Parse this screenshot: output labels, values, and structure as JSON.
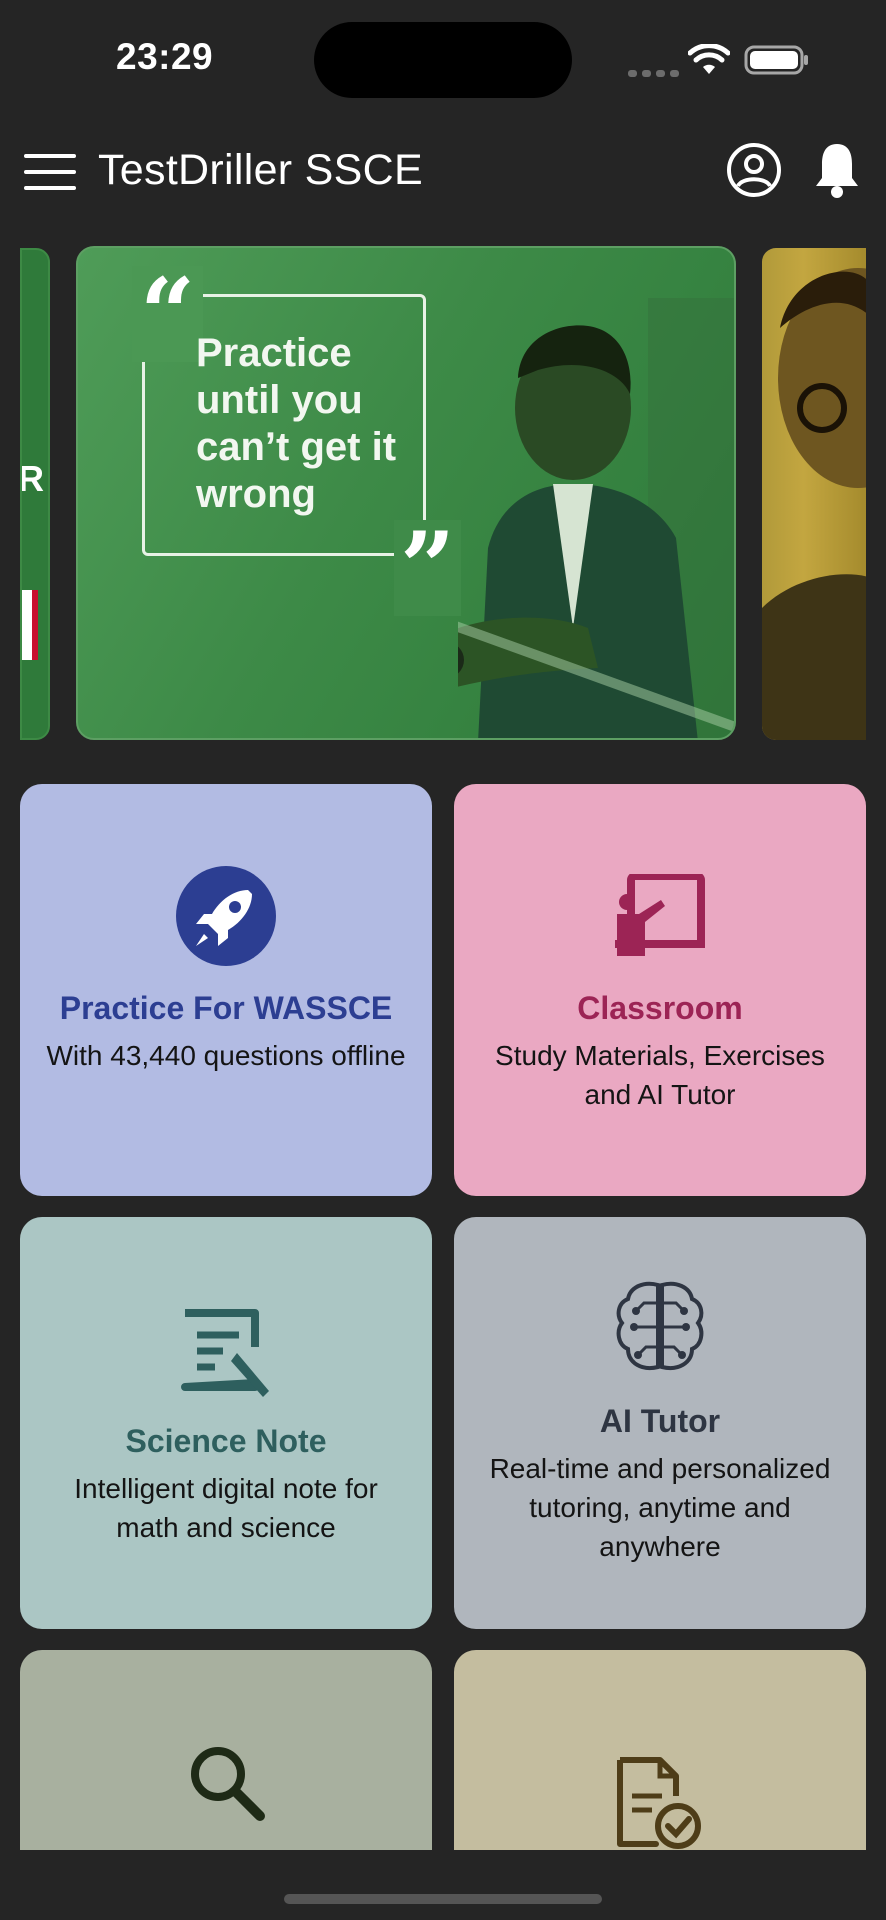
{
  "status_bar": {
    "time": "23:29"
  },
  "app_bar": {
    "title": "TestDriller SSCE",
    "menu_icon": "hamburger-menu-icon",
    "profile_icon": "account-circle-icon",
    "notification_icon": "bell-icon"
  },
  "banner": {
    "quote": "Practice until you can’t get it wrong",
    "background_color": "#3d8a47"
  },
  "cards": {
    "practice": {
      "title": "Practice For WASSCE",
      "description": "With 43,440 questions offline",
      "icon": "rocket-icon",
      "color": "#2c3e92"
    },
    "classroom": {
      "title": "Classroom",
      "description": "Study Materials, Exercises and AI Tutor",
      "icon": "teacher-board-icon",
      "color": "#9c2455"
    },
    "science": {
      "title": "Science Note",
      "description": "Intelligent digital note for math and science",
      "icon": "note-edit-icon",
      "color": "#2e5f5e"
    },
    "ai_tutor": {
      "title": "AI Tutor",
      "description": "Real-time and personalized tutoring, anytime and anywhere",
      "icon": "brain-circuit-icon",
      "color": "#2e3542"
    },
    "search": {
      "icon": "search-icon"
    },
    "exam": {
      "icon": "document-check-icon"
    }
  }
}
